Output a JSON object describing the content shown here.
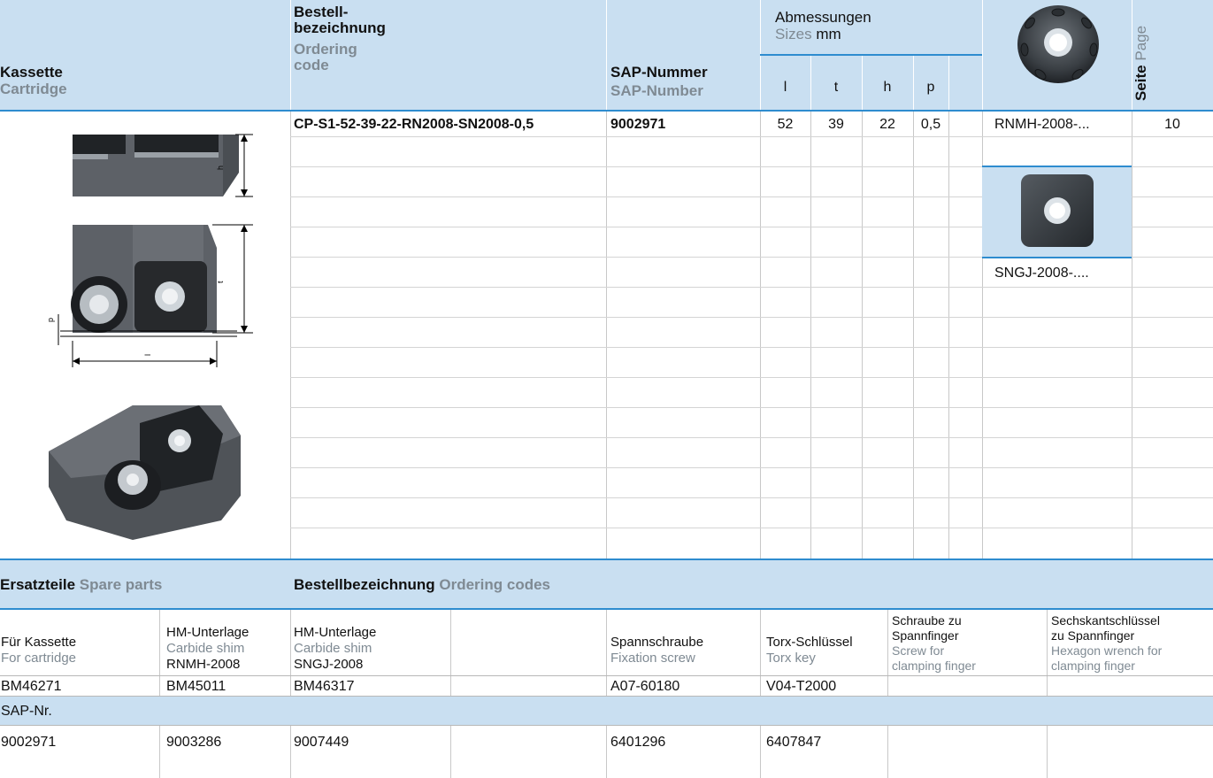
{
  "header": {
    "kassette": "Kassette",
    "cartridge": "Cartridge",
    "bestell_1": "Bestell-",
    "bestell_2": "bezeichnung",
    "ordering_1": "Ordering",
    "ordering_2": "code",
    "sap_de": "SAP-Nummer",
    "sap_en": "SAP-Number",
    "abm_de": "Abmessungen",
    "abm_en": "Sizes",
    "abm_unit": "mm",
    "dims": [
      "l",
      "t",
      "h",
      "p"
    ],
    "seite": "Seite",
    "page": "Page"
  },
  "product": {
    "code": "CP-S1-52-39-22-RN2008-SN2008-0,5",
    "sap": "9002971",
    "l": "52",
    "t": "39",
    "h": "22",
    "p": "0,5",
    "insert1": "RNMH-2008-...",
    "page1": "10",
    "insert2": "SNGJ-2008-...."
  },
  "spare": {
    "title_de": "Ersatzteile",
    "title_en": "Spare parts",
    "codes_de": "Bestellbezeichnung",
    "codes_en": "Ordering codes",
    "cols": [
      {
        "de": "Für Kassette",
        "en": "For cartridge",
        "extra": ""
      },
      {
        "de": "HM-Unterlage",
        "en": "Carbide shim",
        "extra": "RNMH-2008"
      },
      {
        "de": "HM-Unterlage",
        "en": "Carbide shim",
        "extra": "SNGJ-2008"
      },
      {
        "de": "Spannschraube",
        "en": "Fixation screw",
        "extra": ""
      },
      {
        "de": "Torx-Schlüssel",
        "en": "Torx key",
        "extra": ""
      },
      {
        "de1": "Schraube zu",
        "de2": "Spannfinger",
        "en1": "Screw for",
        "en2": "clamping finger"
      },
      {
        "de1": "Sechskantschlüssel",
        "de2": "zu Spannfinger",
        "en1": "Hexagon wrench for",
        "en2": "clamping finger"
      }
    ],
    "codes_row": [
      "BM46271",
      "BM45011",
      "BM46317",
      "A07-60180",
      "V04-T2000"
    ],
    "sap_label": "SAP-Nr.",
    "sap_row": [
      "9002971",
      "9003286",
      "9007449",
      "6401296",
      "6407847"
    ]
  },
  "colors": {
    "header_bg": "#c9dff1",
    "accent": "#2e8ccf",
    "gray_text": "#7f8a93"
  }
}
